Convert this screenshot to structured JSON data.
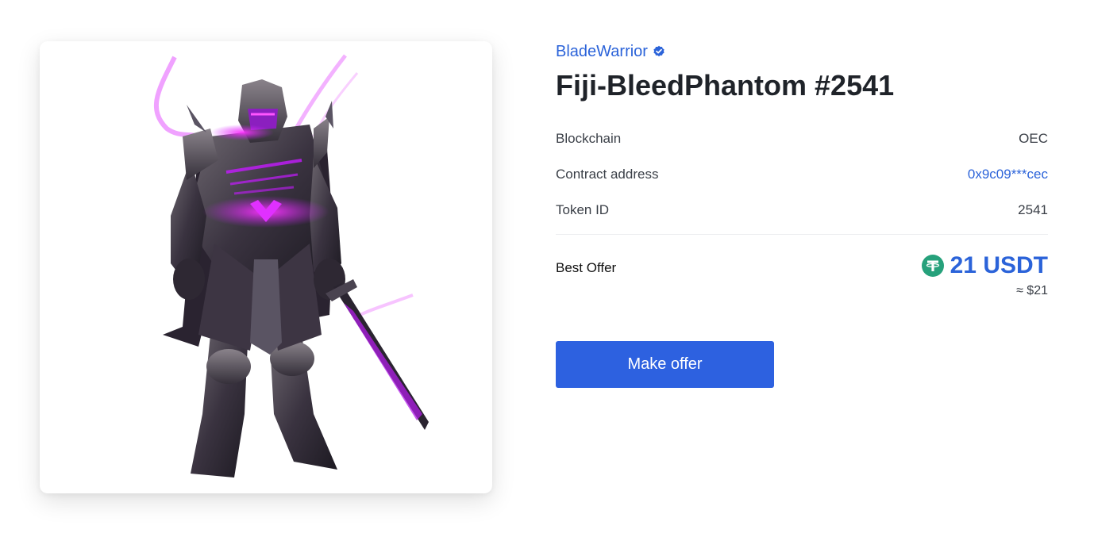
{
  "creator": {
    "name": "BladeWarrior",
    "verified_icon": "verified-badge-icon"
  },
  "nft": {
    "title": "Fiji-BleedPhantom #2541",
    "image_description_icon": "armored-knight-artwork"
  },
  "details": [
    {
      "label": "Blockchain",
      "value": "OEC",
      "is_link": false
    },
    {
      "label": "Contract address",
      "value": "0x9c09***cec",
      "is_link": true
    },
    {
      "label": "Token ID",
      "value": "2541",
      "is_link": false
    }
  ],
  "offer": {
    "label": "Best Offer",
    "amount": "21 USDT",
    "fiat": "≈ $21",
    "currency_icon": "usdt-icon"
  },
  "actions": {
    "make_offer_label": "Make offer"
  },
  "colors": {
    "accent": "#2b63d9",
    "button": "#2d61e0",
    "usdt": "#26a17b",
    "glow": "#cc22ff"
  }
}
